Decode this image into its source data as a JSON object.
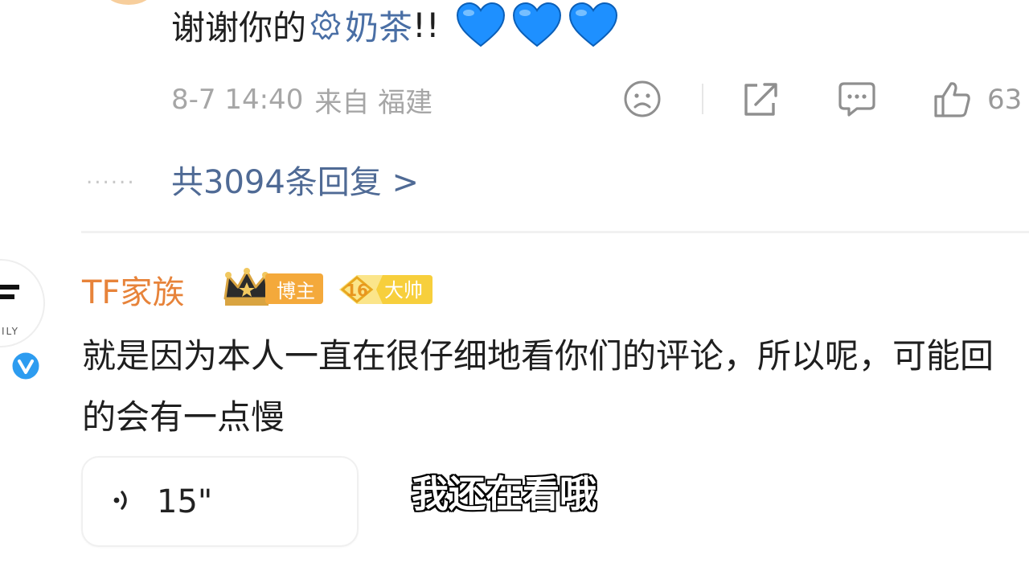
{
  "prev_comment": {
    "text_before": "谢谢你的",
    "topic_text": "奶茶",
    "exclaim": "!!",
    "hearts_icon": "blue-heart-icon",
    "time": "8-7 14:40",
    "source": "来自 福建",
    "like_count": "63",
    "reply_link": "共3094条回复 >",
    "dots": "......"
  },
  "comment": {
    "avatar_letters": "ILY",
    "username": "TF家族",
    "blogger_label": "博主",
    "level_number": "16",
    "level_label": "大帅",
    "text": "就是因为本人一直在很仔细地看你们的评论，所以呢，可能回的会有一点慢",
    "voice_duration": "15\""
  },
  "subtitle": "我还在看哦",
  "colors": {
    "username": "#e7833a",
    "link": "#4f6a95",
    "meta": "#a6a6a6",
    "blogger_badge": "#f4a93b",
    "heart": "#1e90ff",
    "verified": "#2d9cf0"
  }
}
